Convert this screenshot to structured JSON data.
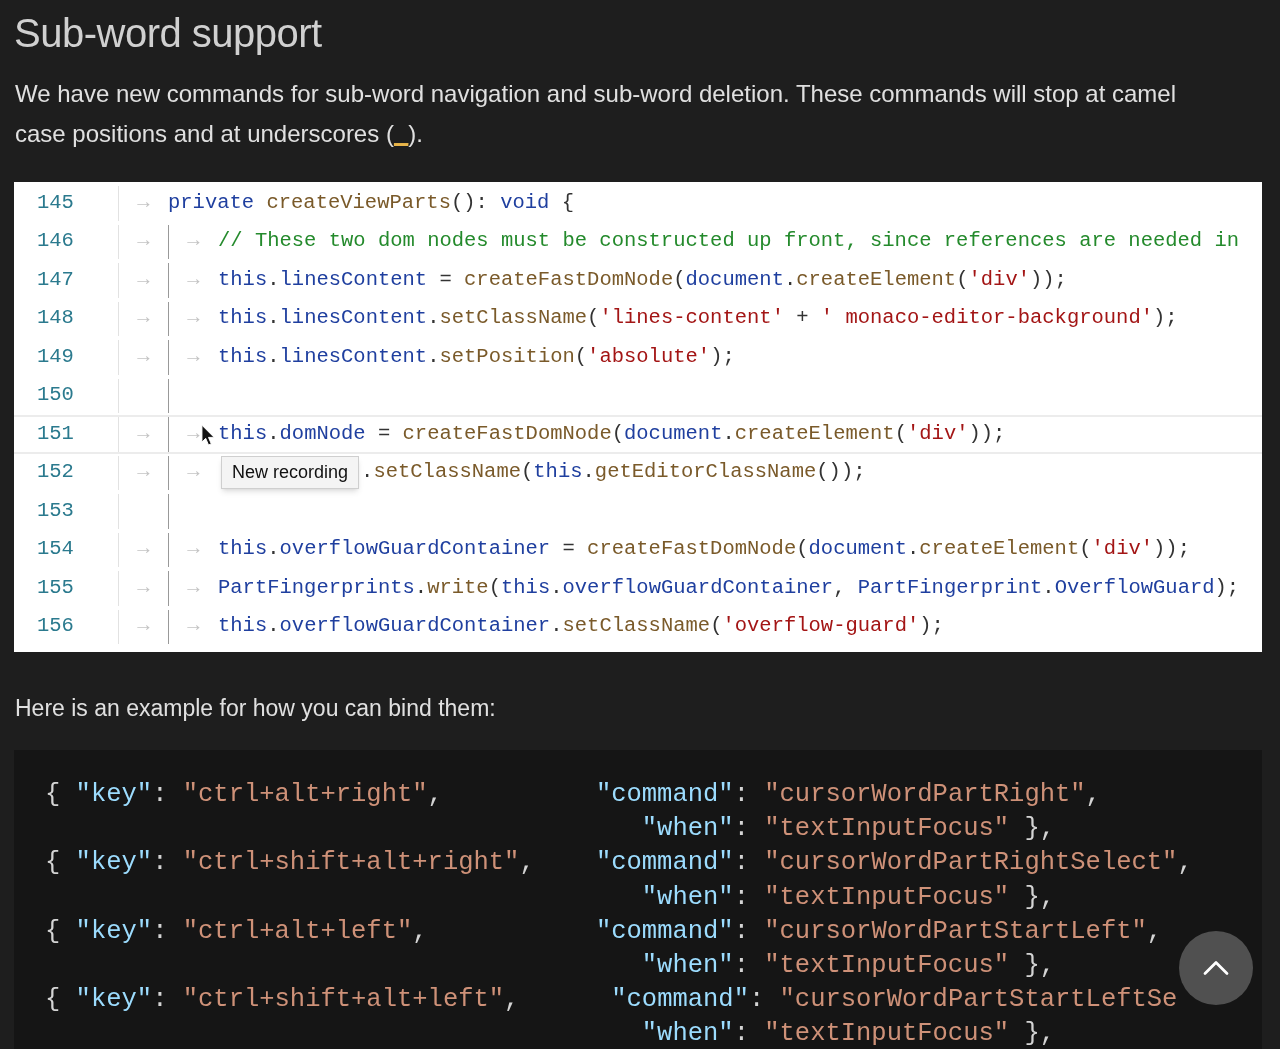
{
  "heading": "Sub-word support",
  "intro": [
    {
      "kind": "text",
      "text": "We have new commands for sub-word navigation and sub-word deletion. These commands will stop at camel case positions and at underscores ("
    },
    {
      "kind": "code",
      "text": "_"
    },
    {
      "kind": "text",
      "text": ")."
    }
  ],
  "code_image": {
    "lines": [
      {
        "number": "145",
        "tabs": [
          "→"
        ],
        "tokens": [
          {
            "kind": "kw",
            "text": "private "
          },
          {
            "kind": "fn",
            "text": "createViewParts"
          },
          {
            "kind": "plain",
            "text": "(): "
          },
          {
            "kind": "kw",
            "text": "void"
          },
          {
            "kind": "plain",
            "text": " {"
          }
        ],
        "children": [
          {
            "number": "146",
            "tabs": [
              "→",
              "→"
            ],
            "tokens": [
              {
                "kind": "comment",
                "text": "// These two dom nodes must be constructed up front, since references are needed in"
              }
            ]
          },
          {
            "number": "147",
            "tabs": [
              "→",
              "→"
            ],
            "tokens": [
              {
                "kind": "kw",
                "text": "this"
              },
              {
                "kind": "plain",
                "text": "."
              },
              {
                "kind": "kw",
                "text": "linesContent"
              },
              {
                "kind": "plain",
                "text": " = "
              },
              {
                "kind": "fn",
                "text": "createFastDomNode"
              },
              {
                "kind": "plain",
                "text": "("
              },
              {
                "kind": "kw",
                "text": "document"
              },
              {
                "kind": "plain",
                "text": "."
              },
              {
                "kind": "fn",
                "text": "createElement"
              },
              {
                "kind": "plain",
                "text": "("
              },
              {
                "kind": "str",
                "text": "'div'"
              },
              {
                "kind": "plain",
                "text": "));"
              }
            ]
          },
          {
            "number": "148",
            "tabs": [
              "→",
              "→"
            ],
            "tokens": [
              {
                "kind": "kw",
                "text": "this"
              },
              {
                "kind": "plain",
                "text": "."
              },
              {
                "kind": "kw",
                "text": "linesContent"
              },
              {
                "kind": "plain",
                "text": "."
              },
              {
                "kind": "fn",
                "text": "setClassName"
              },
              {
                "kind": "plain",
                "text": "("
              },
              {
                "kind": "str",
                "text": "'lines-content'"
              },
              {
                "kind": "plain",
                "text": " + "
              },
              {
                "kind": "str",
                "text": "' monaco-editor-background'"
              },
              {
                "kind": "plain",
                "text": ");"
              }
            ]
          },
          {
            "number": "149",
            "tabs": [
              "→",
              "→"
            ],
            "tokens": [
              {
                "kind": "kw",
                "text": "this"
              },
              {
                "kind": "plain",
                "text": "."
              },
              {
                "kind": "kw",
                "text": "linesContent"
              },
              {
                "kind": "plain",
                "text": "."
              },
              {
                "kind": "fn",
                "text": "setPosition"
              },
              {
                "kind": "plain",
                "text": "("
              },
              {
                "kind": "str",
                "text": "'absolute'"
              },
              {
                "kind": "plain",
                "text": ");"
              }
            ]
          },
          {
            "number": "150"
          },
          {
            "number": "151",
            "current": true,
            "tabs": [
              "→",
              "→"
            ],
            "tokens": [
              {
                "kind": "kw",
                "text": "this"
              },
              {
                "kind": "plain",
                "text": "."
              },
              {
                "kind": "kw",
                "text": "domNode"
              },
              {
                "kind": "plain",
                "text": " = "
              },
              {
                "kind": "fn",
                "text": "createFastDomNode"
              },
              {
                "kind": "plain",
                "text": "("
              },
              {
                "kind": "kw",
                "text": "document"
              },
              {
                "kind": "plain",
                "text": "."
              },
              {
                "kind": "fn",
                "text": "createElement"
              },
              {
                "kind": "plain",
                "text": "("
              },
              {
                "kind": "str",
                "text": "'div'"
              },
              {
                "kind": "plain",
                "text": "));"
              }
            ]
          },
          {
            "number": "152",
            "tabs": [
              "→",
              "→"
            ],
            "tooltip": "New recording",
            "tokens": [
              {
                "kind": "plain",
                "text": "."
              },
              {
                "kind": "fn",
                "text": "setClassName"
              },
              {
                "kind": "plain",
                "text": "("
              },
              {
                "kind": "kw",
                "text": "this"
              },
              {
                "kind": "plain",
                "text": "."
              },
              {
                "kind": "fn",
                "text": "getEditorClassName"
              },
              {
                "kind": "plain",
                "text": "());"
              }
            ]
          },
          {
            "number": "153"
          },
          {
            "number": "154",
            "tabs": [
              "→",
              "→"
            ],
            "tokens": [
              {
                "kind": "kw",
                "text": "this"
              },
              {
                "kind": "plain",
                "text": "."
              },
              {
                "kind": "kw",
                "text": "overflowGuardContainer"
              },
              {
                "kind": "plain",
                "text": " = "
              },
              {
                "kind": "fn",
                "text": "createFastDomNode"
              },
              {
                "kind": "plain",
                "text": "("
              },
              {
                "kind": "kw",
                "text": "document"
              },
              {
                "kind": "plain",
                "text": "."
              },
              {
                "kind": "fn",
                "text": "createElement"
              },
              {
                "kind": "plain",
                "text": "("
              },
              {
                "kind": "str",
                "text": "'div'"
              },
              {
                "kind": "plain",
                "text": "));"
              }
            ]
          },
          {
            "number": "155",
            "tabs": [
              "→",
              "→"
            ],
            "tokens": [
              {
                "kind": "type",
                "text": "PartFingerprints"
              },
              {
                "kind": "plain",
                "text": "."
              },
              {
                "kind": "fn",
                "text": "write"
              },
              {
                "kind": "plain",
                "text": "("
              },
              {
                "kind": "kw",
                "text": "this"
              },
              {
                "kind": "plain",
                "text": "."
              },
              {
                "kind": "kw",
                "text": "overflowGuardContainer"
              },
              {
                "kind": "plain",
                "text": ", "
              },
              {
                "kind": "kw",
                "text": "PartFingerprint"
              },
              {
                "kind": "plain",
                "text": "."
              },
              {
                "kind": "kw",
                "text": "OverflowGuard"
              },
              {
                "kind": "plain",
                "text": ");"
              }
            ]
          },
          {
            "number": "156",
            "tabs": [
              "→",
              "→"
            ],
            "tokens": [
              {
                "kind": "kw",
                "text": "this"
              },
              {
                "kind": "plain",
                "text": "."
              },
              {
                "kind": "kw",
                "text": "overflowGuardContainer"
              },
              {
                "kind": "plain",
                "text": "."
              },
              {
                "kind": "fn",
                "text": "setClassName"
              },
              {
                "kind": "plain",
                "text": "("
              },
              {
                "kind": "str",
                "text": "'overflow-guard'"
              },
              {
                "kind": "plain",
                "text": ");"
              }
            ]
          }
        ]
      }
    ]
  },
  "example_label": "Here is an example for how you can bind them:",
  "code_block": [
    [
      {
        "kind": "punct",
        "text": "{ "
      },
      {
        "kind": "prop",
        "text": "\"key\""
      },
      {
        "kind": "punct",
        "text": ": "
      },
      {
        "kind": "str",
        "text": "\"ctrl+alt+right\""
      },
      {
        "kind": "punct",
        "text": ",          "
      },
      {
        "kind": "prop",
        "text": "\"command\""
      },
      {
        "kind": "punct",
        "text": ": "
      },
      {
        "kind": "str",
        "text": "\"cursorWordPartRight\""
      },
      {
        "kind": "punct",
        "text": ","
      }
    ],
    [
      {
        "kind": "prop",
        "text": "                                       \"when\""
      },
      {
        "kind": "punct",
        "text": ": "
      },
      {
        "kind": "str",
        "text": "\"textInputFocus\""
      },
      {
        "kind": "punct",
        "text": " },"
      }
    ],
    [
      {
        "kind": "punct",
        "text": "{ "
      },
      {
        "kind": "prop",
        "text": "\"key\""
      },
      {
        "kind": "punct",
        "text": ": "
      },
      {
        "kind": "str",
        "text": "\"ctrl+shift+alt+right\""
      },
      {
        "kind": "punct",
        "text": ",    "
      },
      {
        "kind": "prop",
        "text": "\"command\""
      },
      {
        "kind": "punct",
        "text": ": "
      },
      {
        "kind": "str",
        "text": "\"cursorWordPartRightSelect\""
      },
      {
        "kind": "punct",
        "text": ","
      }
    ],
    [
      {
        "kind": "prop",
        "text": "                                       \"when\""
      },
      {
        "kind": "punct",
        "text": ": "
      },
      {
        "kind": "str",
        "text": "\"textInputFocus\""
      },
      {
        "kind": "punct",
        "text": " },"
      }
    ],
    [
      {
        "kind": "punct",
        "text": "{ "
      },
      {
        "kind": "prop",
        "text": "\"key\""
      },
      {
        "kind": "punct",
        "text": ": "
      },
      {
        "kind": "str",
        "text": "\"ctrl+alt+left\""
      },
      {
        "kind": "punct",
        "text": ",           "
      },
      {
        "kind": "prop",
        "text": "\"command\""
      },
      {
        "kind": "punct",
        "text": ": "
      },
      {
        "kind": "str",
        "text": "\"cursorWordPartStartLeft\""
      },
      {
        "kind": "punct",
        "text": ","
      }
    ],
    [
      {
        "kind": "prop",
        "text": "                                       \"when\""
      },
      {
        "kind": "punct",
        "text": ": "
      },
      {
        "kind": "str",
        "text": "\"textInputFocus\""
      },
      {
        "kind": "punct",
        "text": " },"
      }
    ],
    [
      {
        "kind": "punct",
        "text": "{ "
      },
      {
        "kind": "prop",
        "text": "\"key\""
      },
      {
        "kind": "punct",
        "text": ": "
      },
      {
        "kind": "str",
        "text": "\"ctrl+shift+alt+left\""
      },
      {
        "kind": "punct",
        "text": ",      "
      },
      {
        "kind": "prop",
        "text": "\"command\""
      },
      {
        "kind": "punct",
        "text": ": "
      },
      {
        "kind": "str",
        "text": "\"cursorWordPartStartLeftSe"
      }
    ],
    [
      {
        "kind": "prop",
        "text": "                                       \"when\""
      },
      {
        "kind": "punct",
        "text": ": "
      },
      {
        "kind": "str",
        "text": "\"textInputFocus\""
      },
      {
        "kind": "punct",
        "text": " },"
      }
    ]
  ]
}
